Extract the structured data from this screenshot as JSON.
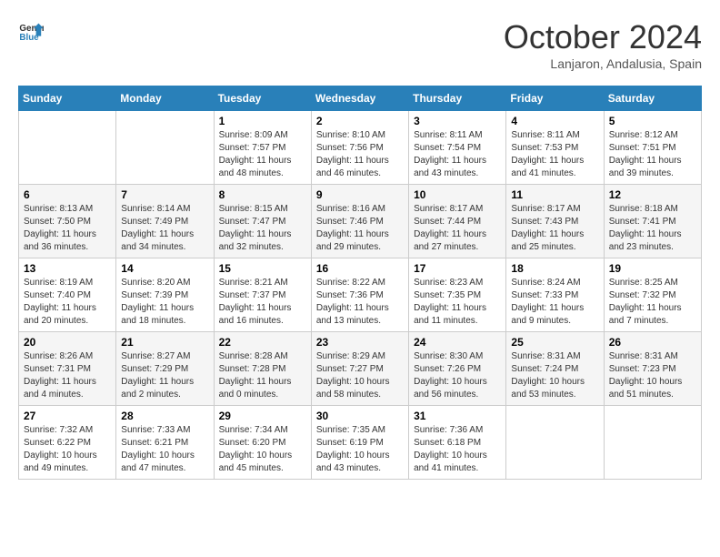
{
  "header": {
    "logo_line1": "General",
    "logo_line2": "Blue",
    "month_title": "October 2024",
    "subtitle": "Lanjaron, Andalusia, Spain"
  },
  "days_of_week": [
    "Sunday",
    "Monday",
    "Tuesday",
    "Wednesday",
    "Thursday",
    "Friday",
    "Saturday"
  ],
  "weeks": [
    [
      {
        "day": "",
        "info": ""
      },
      {
        "day": "",
        "info": ""
      },
      {
        "day": "1",
        "info": "Sunrise: 8:09 AM\nSunset: 7:57 PM\nDaylight: 11 hours and 48 minutes."
      },
      {
        "day": "2",
        "info": "Sunrise: 8:10 AM\nSunset: 7:56 PM\nDaylight: 11 hours and 46 minutes."
      },
      {
        "day": "3",
        "info": "Sunrise: 8:11 AM\nSunset: 7:54 PM\nDaylight: 11 hours and 43 minutes."
      },
      {
        "day": "4",
        "info": "Sunrise: 8:11 AM\nSunset: 7:53 PM\nDaylight: 11 hours and 41 minutes."
      },
      {
        "day": "5",
        "info": "Sunrise: 8:12 AM\nSunset: 7:51 PM\nDaylight: 11 hours and 39 minutes."
      }
    ],
    [
      {
        "day": "6",
        "info": "Sunrise: 8:13 AM\nSunset: 7:50 PM\nDaylight: 11 hours and 36 minutes."
      },
      {
        "day": "7",
        "info": "Sunrise: 8:14 AM\nSunset: 7:49 PM\nDaylight: 11 hours and 34 minutes."
      },
      {
        "day": "8",
        "info": "Sunrise: 8:15 AM\nSunset: 7:47 PM\nDaylight: 11 hours and 32 minutes."
      },
      {
        "day": "9",
        "info": "Sunrise: 8:16 AM\nSunset: 7:46 PM\nDaylight: 11 hours and 29 minutes."
      },
      {
        "day": "10",
        "info": "Sunrise: 8:17 AM\nSunset: 7:44 PM\nDaylight: 11 hours and 27 minutes."
      },
      {
        "day": "11",
        "info": "Sunrise: 8:17 AM\nSunset: 7:43 PM\nDaylight: 11 hours and 25 minutes."
      },
      {
        "day": "12",
        "info": "Sunrise: 8:18 AM\nSunset: 7:41 PM\nDaylight: 11 hours and 23 minutes."
      }
    ],
    [
      {
        "day": "13",
        "info": "Sunrise: 8:19 AM\nSunset: 7:40 PM\nDaylight: 11 hours and 20 minutes."
      },
      {
        "day": "14",
        "info": "Sunrise: 8:20 AM\nSunset: 7:39 PM\nDaylight: 11 hours and 18 minutes."
      },
      {
        "day": "15",
        "info": "Sunrise: 8:21 AM\nSunset: 7:37 PM\nDaylight: 11 hours and 16 minutes."
      },
      {
        "day": "16",
        "info": "Sunrise: 8:22 AM\nSunset: 7:36 PM\nDaylight: 11 hours and 13 minutes."
      },
      {
        "day": "17",
        "info": "Sunrise: 8:23 AM\nSunset: 7:35 PM\nDaylight: 11 hours and 11 minutes."
      },
      {
        "day": "18",
        "info": "Sunrise: 8:24 AM\nSunset: 7:33 PM\nDaylight: 11 hours and 9 minutes."
      },
      {
        "day": "19",
        "info": "Sunrise: 8:25 AM\nSunset: 7:32 PM\nDaylight: 11 hours and 7 minutes."
      }
    ],
    [
      {
        "day": "20",
        "info": "Sunrise: 8:26 AM\nSunset: 7:31 PM\nDaylight: 11 hours and 4 minutes."
      },
      {
        "day": "21",
        "info": "Sunrise: 8:27 AM\nSunset: 7:29 PM\nDaylight: 11 hours and 2 minutes."
      },
      {
        "day": "22",
        "info": "Sunrise: 8:28 AM\nSunset: 7:28 PM\nDaylight: 11 hours and 0 minutes."
      },
      {
        "day": "23",
        "info": "Sunrise: 8:29 AM\nSunset: 7:27 PM\nDaylight: 10 hours and 58 minutes."
      },
      {
        "day": "24",
        "info": "Sunrise: 8:30 AM\nSunset: 7:26 PM\nDaylight: 10 hours and 56 minutes."
      },
      {
        "day": "25",
        "info": "Sunrise: 8:31 AM\nSunset: 7:24 PM\nDaylight: 10 hours and 53 minutes."
      },
      {
        "day": "26",
        "info": "Sunrise: 8:31 AM\nSunset: 7:23 PM\nDaylight: 10 hours and 51 minutes."
      }
    ],
    [
      {
        "day": "27",
        "info": "Sunrise: 7:32 AM\nSunset: 6:22 PM\nDaylight: 10 hours and 49 minutes."
      },
      {
        "day": "28",
        "info": "Sunrise: 7:33 AM\nSunset: 6:21 PM\nDaylight: 10 hours and 47 minutes."
      },
      {
        "day": "29",
        "info": "Sunrise: 7:34 AM\nSunset: 6:20 PM\nDaylight: 10 hours and 45 minutes."
      },
      {
        "day": "30",
        "info": "Sunrise: 7:35 AM\nSunset: 6:19 PM\nDaylight: 10 hours and 43 minutes."
      },
      {
        "day": "31",
        "info": "Sunrise: 7:36 AM\nSunset: 6:18 PM\nDaylight: 10 hours and 41 minutes."
      },
      {
        "day": "",
        "info": ""
      },
      {
        "day": "",
        "info": ""
      }
    ]
  ]
}
